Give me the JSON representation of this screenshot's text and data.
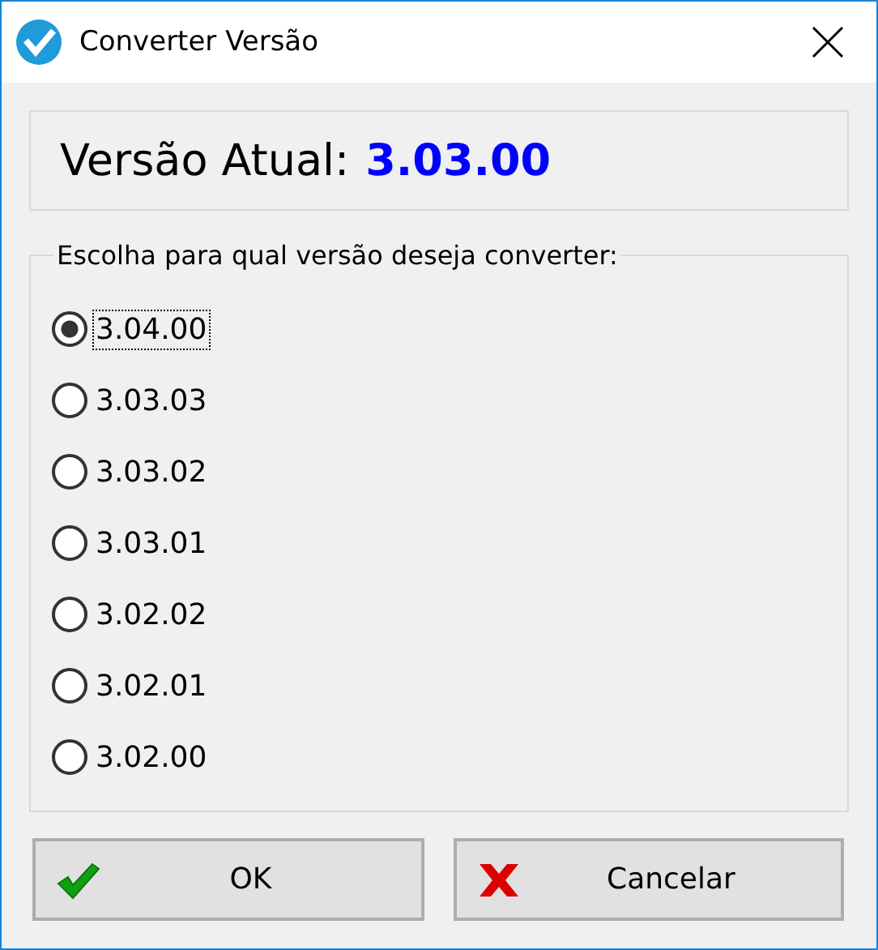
{
  "window": {
    "title": "Converter Versão"
  },
  "current_version": {
    "label": "Versão Atual:",
    "value": "3.03.00"
  },
  "version_group": {
    "caption": "Escolha para qual versão deseja converter:",
    "options": [
      {
        "label": "3.04.00",
        "selected": true
      },
      {
        "label": "3.03.03",
        "selected": false
      },
      {
        "label": "3.03.02",
        "selected": false
      },
      {
        "label": "3.03.01",
        "selected": false
      },
      {
        "label": "3.02.02",
        "selected": false
      },
      {
        "label": "3.02.01",
        "selected": false
      },
      {
        "label": "3.02.00",
        "selected": false
      }
    ]
  },
  "buttons": [
    {
      "kind": "ok",
      "label": "OK"
    },
    {
      "kind": "cancel",
      "label": "Cancelar"
    }
  ]
}
